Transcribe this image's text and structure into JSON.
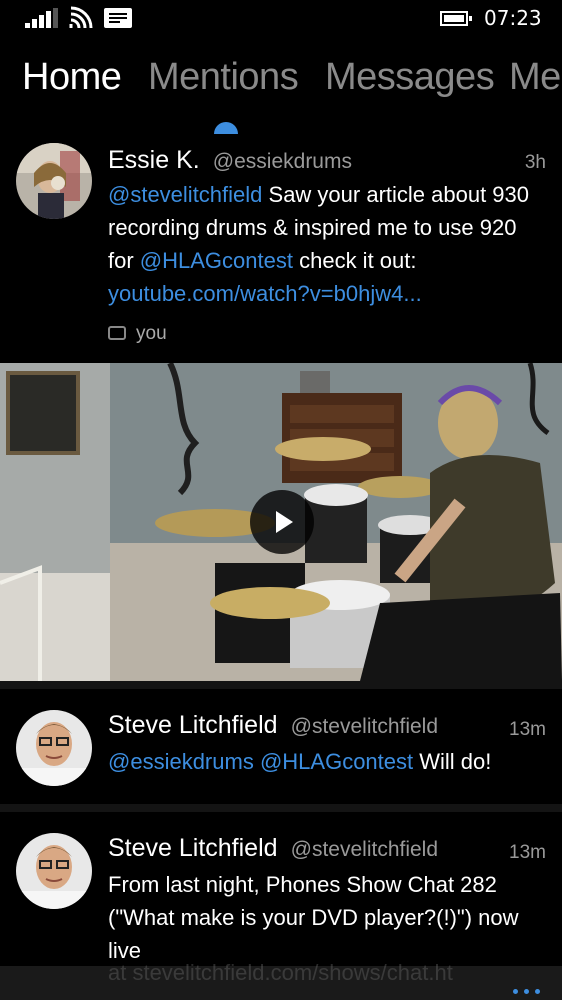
{
  "status_bar": {
    "time": "07:23",
    "icons": [
      "signal-icon",
      "wifi-icon",
      "message-icon",
      "battery-icon"
    ]
  },
  "pivot": {
    "tabs": [
      "Home",
      "Mentions",
      "Messages",
      "Me"
    ],
    "active_tab": "Home"
  },
  "tweets": [
    {
      "name": "Essie K.",
      "handle": "@essiekdrums",
      "time": "3h",
      "body_mention": "@stevelitchfield",
      "body_text": " Saw your article about 930 recording drums & inspired me to use 920 for ",
      "body_mention2": "@HLAGcontest",
      "body_text2": " check it out: ",
      "body_link": "youtube.com/watch?v=b0hjw4...",
      "retweet_label": "you"
    },
    {
      "name": "Steve Litchfield",
      "handle": "@stevelitchfield",
      "time": "13m",
      "body_mention": "@essiekdrums",
      "body_mention2": "@HLAGcontest",
      "body_text": " Will do!"
    },
    {
      "name": "Steve Litchfield",
      "handle": "@stevelitchfield",
      "time": "13m",
      "body_text": "From last night, Phones Show Chat 282 (\"What make is your DVD player?(!)\") now live"
    }
  ],
  "app_bar": {
    "ghost_text": "at stevelitchfield.com/shows/chat.ht",
    "more_icon": "ellipsis-icon"
  },
  "colors": {
    "accent": "#3d8ee0",
    "background": "#000000",
    "secondary_text": "#9a9a9a"
  }
}
